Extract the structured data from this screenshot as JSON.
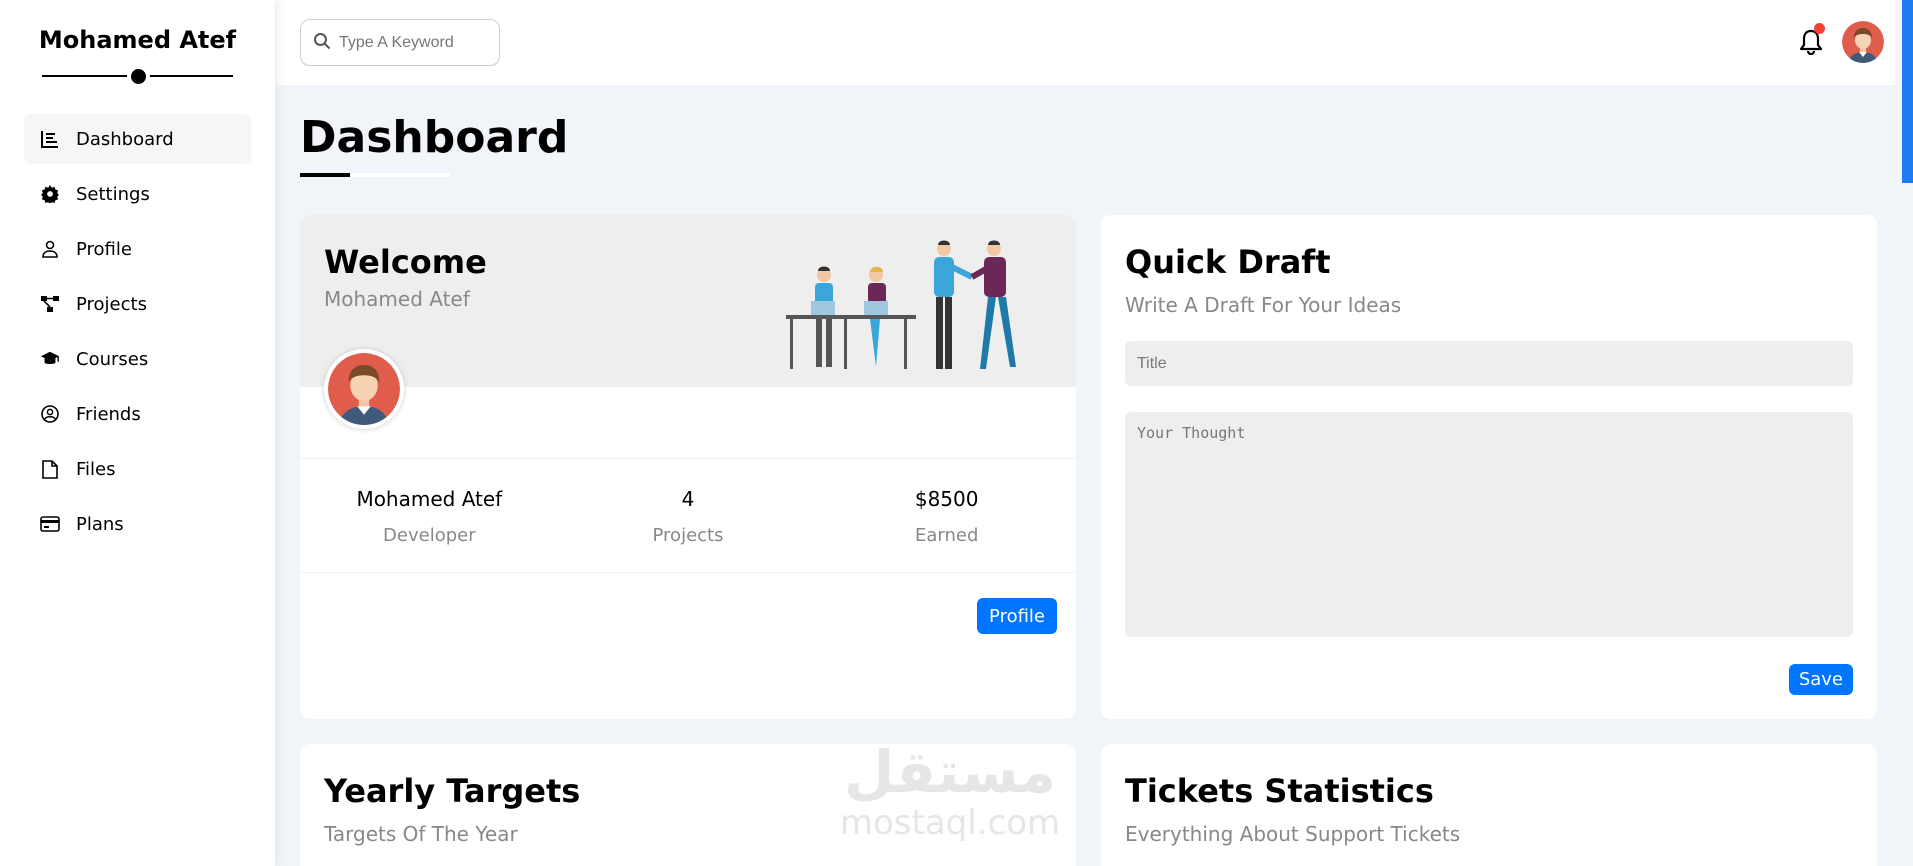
{
  "sidebar": {
    "brand": "Mohamed Atef",
    "items": [
      {
        "label": "Dashboard",
        "icon": "chart-icon",
        "active": true
      },
      {
        "label": "Settings",
        "icon": "gear-icon"
      },
      {
        "label": "Profile",
        "icon": "user-icon"
      },
      {
        "label": "Projects",
        "icon": "diagram-icon"
      },
      {
        "label": "Courses",
        "icon": "graduation-cap-icon"
      },
      {
        "label": "Friends",
        "icon": "user-circle-icon"
      },
      {
        "label": "Files",
        "icon": "file-icon"
      },
      {
        "label": "Plans",
        "icon": "credit-card-icon"
      }
    ]
  },
  "header": {
    "search_placeholder": "Type A Keyword",
    "notification_color": "#f44336"
  },
  "page": {
    "title": "Dashboard"
  },
  "welcome": {
    "title": "Welcome",
    "name": "Mohamed Atef",
    "stats": [
      {
        "value": "Mohamed Atef",
        "label": "Developer"
      },
      {
        "value": "4",
        "label": "Projects"
      },
      {
        "value": "$8500",
        "label": "Earned"
      }
    ],
    "button": "Profile"
  },
  "draft": {
    "title": "Quick Draft",
    "subtitle": "Write A Draft For Your Ideas",
    "title_placeholder": "Title",
    "thought_placeholder": "Your Thought",
    "button": "Save"
  },
  "targets": {
    "title": "Yearly Targets",
    "subtitle": "Targets Of The Year"
  },
  "tickets": {
    "title": "Tickets Statistics",
    "subtitle": "Everything About Support Tickets"
  },
  "watermark": {
    "arabic": "مستقل",
    "latin": "mostaql.com"
  },
  "colors": {
    "accent": "#0075ff",
    "background": "#f1f5f9",
    "card": "#ffffff"
  }
}
